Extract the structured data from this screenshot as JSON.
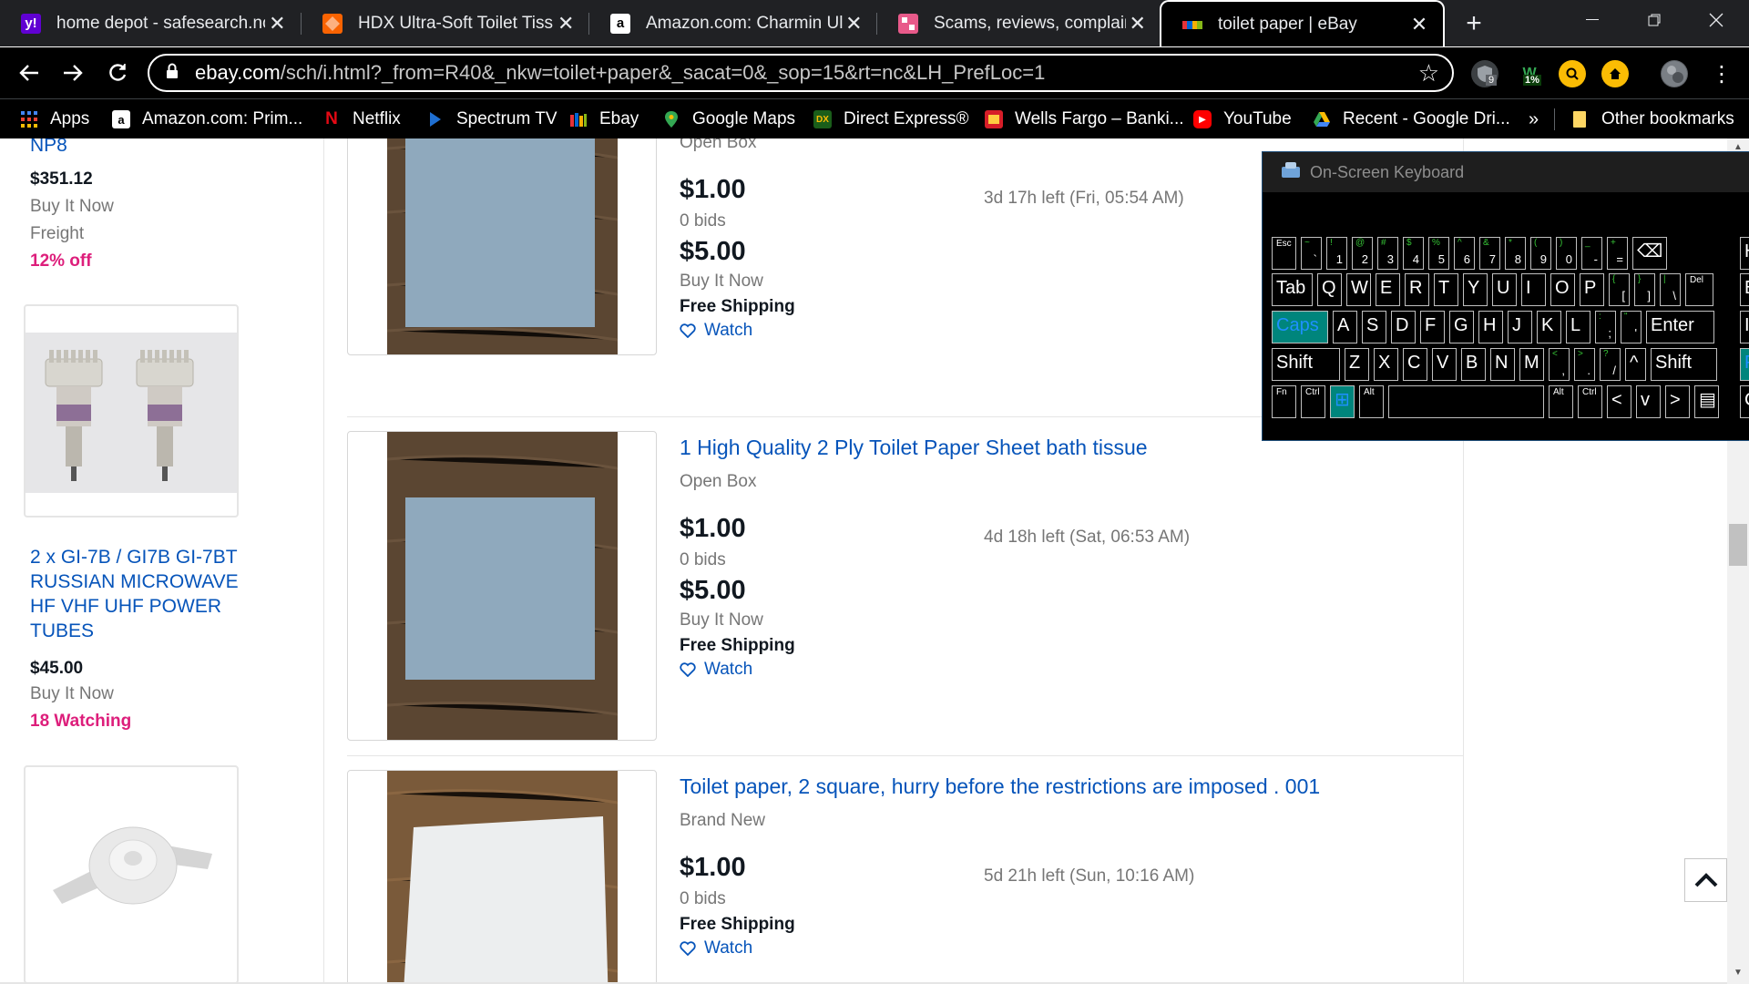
{
  "browser": {
    "tabs": [
      {
        "title": "home depot - safesearch.nc",
        "icon": "yahoo-icon",
        "color": "#6001d2",
        "glyph": "y!"
      },
      {
        "title": "HDX Ultra-Soft Toilet Tissue",
        "icon": "homedepot-icon",
        "color": "#f96302",
        "glyph": ""
      },
      {
        "title": "Amazon.com: Charmin Ultra",
        "icon": "amazon-icon",
        "color": "#ffffff",
        "glyph": "a"
      },
      {
        "title": "Scams, reviews, complaints,",
        "icon": "site-icon",
        "color": "#e85a8a",
        "glyph": ""
      },
      {
        "title": "toilet paper | eBay",
        "icon": "ebay-icon",
        "color": "#e53238",
        "glyph": ""
      }
    ],
    "new_tab": "+",
    "url_host": "ebay.com",
    "url_rest": "/sch/i.html?_from=R40&_nkw=toilet+paper&_sacat=0&_sop=15&rt=nc&LH_PrefLoc=1",
    "ext_badges": {
      "shield": "9",
      "w": "1%"
    },
    "bookmarks": [
      {
        "label": "Apps",
        "color": "#4285f4",
        "glyph": ""
      },
      {
        "label": "Amazon.com: Prim...",
        "color": "#ffffff",
        "glyph": "a"
      },
      {
        "label": "Netflix",
        "color": "#e50914",
        "glyph": "N"
      },
      {
        "label": "Spectrum TV",
        "color": "#1f6fd1",
        "glyph": ""
      },
      {
        "label": "Ebay",
        "color": "#f5af02",
        "glyph": ""
      },
      {
        "label": "Google Maps",
        "color": "#34a853",
        "glyph": ""
      },
      {
        "label": "Direct Express®",
        "color": "#1a5e1a",
        "glyph": "DX"
      },
      {
        "label": "Wells Fargo – Banki...",
        "color": "#d71e28",
        "glyph": ""
      },
      {
        "label": "YouTube",
        "color": "#ff0000",
        "glyph": "▶"
      },
      {
        "label": "Recent - Google Dri...",
        "color": "#fbbc04",
        "glyph": ""
      }
    ],
    "more_bookmarks": "»",
    "other_bookmarks": "Other bookmarks"
  },
  "left_rail": {
    "top_partial_title": "NP8",
    "item1": {
      "price": "$351.12",
      "format": "Buy It Now",
      "shipping": "Freight",
      "discount": "12% off"
    },
    "item2": {
      "title": "2 x GI-7B / GI7B GI-7BT RUSSIAN MICROWAVE HF VHF UHF POWER TUBES",
      "price": "$45.00",
      "format": "Buy It Now",
      "watching": "18 Watching"
    }
  },
  "results": [
    {
      "title": "",
      "condition": "Open Box",
      "bid_price": "$1.00",
      "bids": "0 bids",
      "bin_price": "$5.00",
      "bin_label": "Buy It Now",
      "shipping": "Free Shipping",
      "watch": "Watch",
      "time_left": "3d 17h left (Fri, 05:54 AM)"
    },
    {
      "title": "1 High Quality 2 Ply Toilet Paper Sheet bath tissue",
      "condition": "Open Box",
      "bid_price": "$1.00",
      "bids": "0 bids",
      "bin_price": "$5.00",
      "bin_label": "Buy It Now",
      "shipping": "Free Shipping",
      "watch": "Watch",
      "time_left": "4d 18h left (Sat, 06:53 AM)"
    },
    {
      "title": "Toilet paper, 2 square, hurry before the restrictions are imposed . 001",
      "condition": "Brand New",
      "bid_price": "$1.00",
      "bids": "0 bids",
      "shipping": "Free Shipping",
      "watch": "Watch",
      "time_left": "5d 21h left (Sun, 10:16 AM)"
    }
  ],
  "osk": {
    "title": "On-Screen Keyboard",
    "row1": [
      {
        "main": "Esc",
        "small": true
      },
      {
        "main": "`",
        "sec": "~"
      },
      {
        "main": "1",
        "sec": "!"
      },
      {
        "main": "2",
        "sec": "@"
      },
      {
        "main": "3",
        "sec": "#"
      },
      {
        "main": "4",
        "sec": "$"
      },
      {
        "main": "5",
        "sec": "%"
      },
      {
        "main": "6",
        "sec": "^"
      },
      {
        "main": "7",
        "sec": "&"
      },
      {
        "main": "8",
        "sec": "*"
      },
      {
        "main": "9",
        "sec": "("
      },
      {
        "main": "0",
        "sec": ")"
      },
      {
        "main": "-",
        "sec": "_"
      },
      {
        "main": "=",
        "sec": "+"
      },
      {
        "main": "⌫"
      }
    ],
    "row2": [
      {
        "main": "Tab"
      },
      {
        "main": "Q"
      },
      {
        "main": "W"
      },
      {
        "main": "E"
      },
      {
        "main": "R"
      },
      {
        "main": "T"
      },
      {
        "main": "Y"
      },
      {
        "main": "U"
      },
      {
        "main": "I"
      },
      {
        "main": "O"
      },
      {
        "main": "P"
      },
      {
        "main": "[",
        "sec": "{"
      },
      {
        "main": "]",
        "sec": "}"
      },
      {
        "main": "\\",
        "sec": "|"
      },
      {
        "main": "Del",
        "small": true
      }
    ],
    "row3": [
      {
        "main": "Caps",
        "teal": true
      },
      {
        "main": "A"
      },
      {
        "main": "S"
      },
      {
        "main": "D"
      },
      {
        "main": "F"
      },
      {
        "main": "G"
      },
      {
        "main": "H"
      },
      {
        "main": "J"
      },
      {
        "main": "K"
      },
      {
        "main": "L"
      },
      {
        "main": ";",
        "sec": ":"
      },
      {
        "main": "'",
        "sec": "\""
      },
      {
        "main": "Enter"
      }
    ],
    "row4": [
      {
        "main": "Shift"
      },
      {
        "main": "Z"
      },
      {
        "main": "X"
      },
      {
        "main": "C"
      },
      {
        "main": "V"
      },
      {
        "main": "B"
      },
      {
        "main": "N"
      },
      {
        "main": "M"
      },
      {
        "main": ",",
        "sec": "<"
      },
      {
        "main": ".",
        "sec": ">"
      },
      {
        "main": "/",
        "sec": "?"
      },
      {
        "main": "^"
      },
      {
        "main": "Shift"
      }
    ],
    "row5": [
      {
        "main": "Fn",
        "small": true
      },
      {
        "main": "Ctrl",
        "small": true
      },
      {
        "main": "⊞",
        "teal": true
      },
      {
        "main": "Alt",
        "small": true
      },
      {
        "main": ""
      },
      {
        "main": "Alt",
        "small": true
      },
      {
        "main": "Ctrl",
        "small": true
      },
      {
        "main": "<"
      },
      {
        "main": "v"
      },
      {
        "main": ">"
      },
      {
        "main": "▤"
      }
    ],
    "right_edge": [
      "H",
      "E",
      "In",
      "P",
      "C"
    ]
  },
  "colors": {
    "ebay_link": "#0654ba",
    "pink": "#dd1e7b",
    "osk_teal": "#00857c"
  }
}
